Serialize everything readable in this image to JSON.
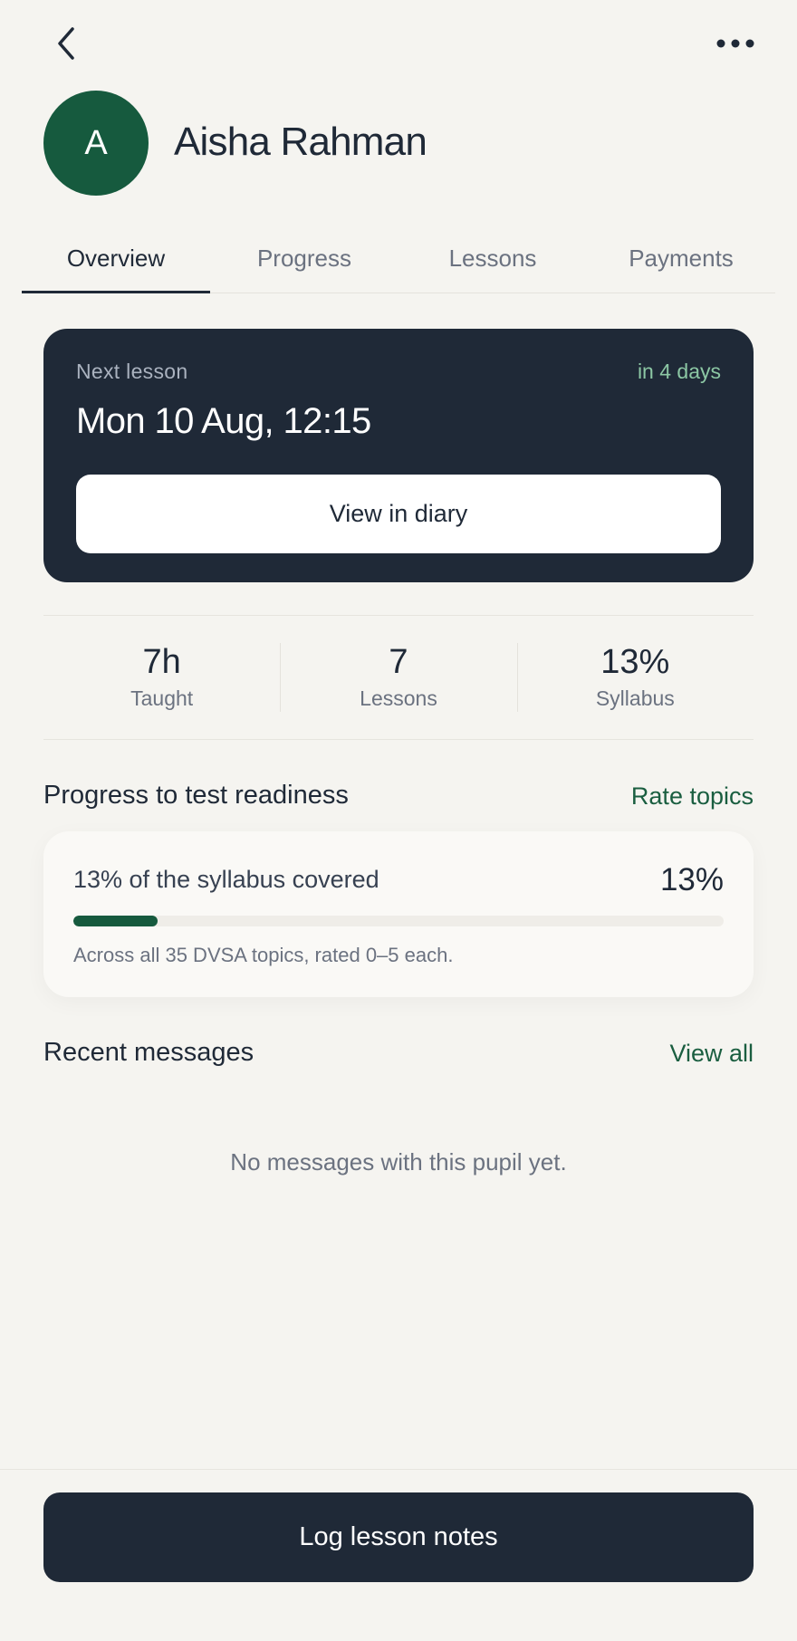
{
  "icons": {
    "back": "chevron-left-icon",
    "more": "more-horizontal-icon"
  },
  "colors": {
    "accent": "#165a3e",
    "dark": "#1f2937",
    "link": "#1a5e40",
    "background": "#f5f4f0"
  },
  "pupil": {
    "initial": "A",
    "name": "Aisha Rahman"
  },
  "tabs": [
    {
      "label": "Overview",
      "active": true
    },
    {
      "label": "Progress",
      "active": false
    },
    {
      "label": "Lessons",
      "active": false
    },
    {
      "label": "Payments",
      "active": false
    }
  ],
  "next_lesson": {
    "label": "Next lesson",
    "relative": "in 4 days",
    "datetime": "Mon 10 Aug, 12:15",
    "button_label": "View in diary"
  },
  "stats": [
    {
      "value": "7h",
      "label": "Taught"
    },
    {
      "value": "7",
      "label": "Lessons"
    },
    {
      "value": "13%",
      "label": "Syllabus"
    }
  ],
  "progress": {
    "title": "Progress to test readiness",
    "link": "Rate topics",
    "summary": "13% of the syllabus covered",
    "percent_label": "13%",
    "percent": 13,
    "note": "Across all 35 DVSA topics, rated 0–5 each."
  },
  "messages": {
    "title": "Recent messages",
    "link": "View all",
    "empty": "No messages with this pupil yet."
  },
  "footer": {
    "button_label": "Log lesson notes"
  }
}
